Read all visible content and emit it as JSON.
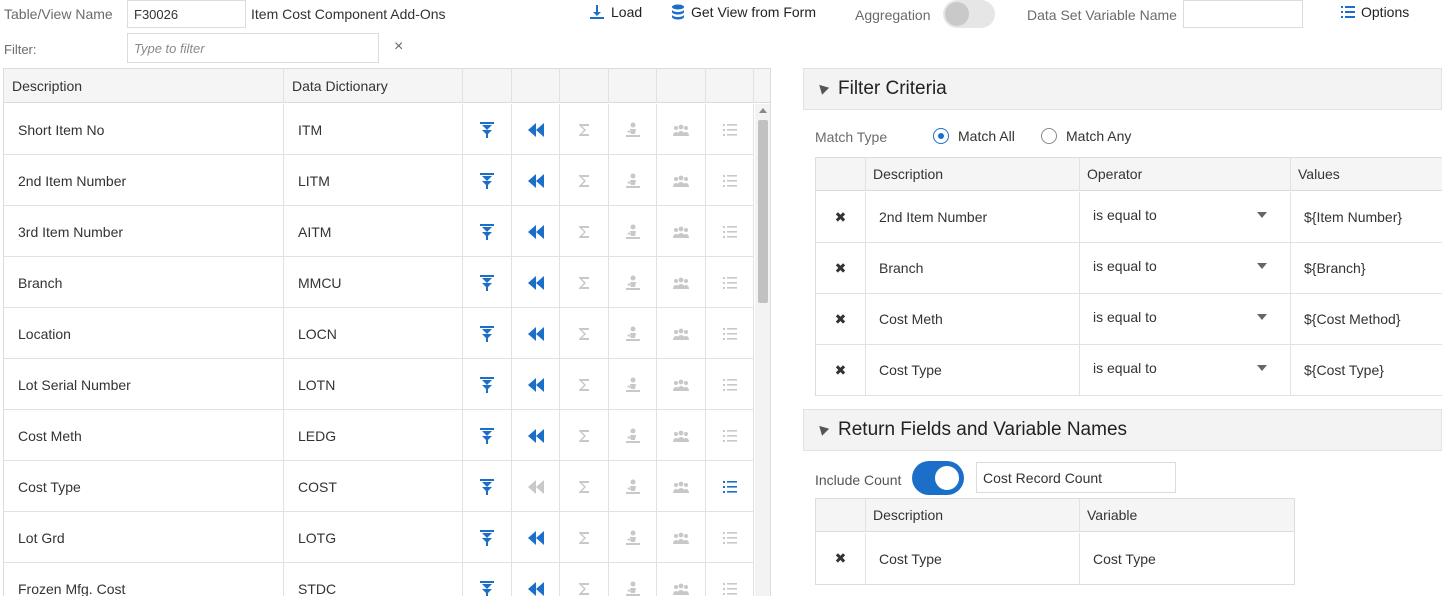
{
  "toolbar": {
    "table_view_label": "Table/View Name",
    "table_view_value": "F30026",
    "table_description": "Item Cost Component Add-Ons",
    "load_label": "Load",
    "get_view_label": "Get View from Form",
    "aggregation_label": "Aggregation",
    "aggregation_on": false,
    "dataset_var_label": "Data Set Variable Name",
    "dataset_var_value": "",
    "options_label": "Options",
    "filter_label": "Filter:",
    "filter_placeholder": "Type to filter",
    "clear_label": "×"
  },
  "columns_grid": {
    "headers": [
      "Description",
      "Data Dictionary"
    ],
    "rows": [
      {
        "description": "Short Item No",
        "dd": "ITM",
        "return_enabled": true,
        "list_active": false
      },
      {
        "description": "2nd Item Number",
        "dd": "LITM",
        "return_enabled": true,
        "list_active": false
      },
      {
        "description": "3rd Item Number",
        "dd": "AITM",
        "return_enabled": true,
        "list_active": false
      },
      {
        "description": "Branch",
        "dd": "MMCU",
        "return_enabled": true,
        "list_active": false
      },
      {
        "description": "Location",
        "dd": "LOCN",
        "return_enabled": true,
        "list_active": false
      },
      {
        "description": "Lot Serial Number",
        "dd": "LOTN",
        "return_enabled": true,
        "list_active": false
      },
      {
        "description": "Cost Meth",
        "dd": "LEDG",
        "return_enabled": true,
        "list_active": false
      },
      {
        "description": "Cost Type",
        "dd": "COST",
        "return_enabled": false,
        "list_active": true
      },
      {
        "description": "Lot Grd",
        "dd": "LOTG",
        "return_enabled": true,
        "list_active": false
      },
      {
        "description": "Frozen Mfg. Cost",
        "dd": "STDC",
        "return_enabled": true,
        "list_active": false
      }
    ],
    "icons": {
      "filter": "filter-down-icon",
      "return": "double-chevron-left-icon",
      "sum": "sigma-icon",
      "person": "person-chart-icon",
      "group": "group-icon",
      "list": "list-icon"
    }
  },
  "filter_criteria": {
    "title": "Filter Criteria",
    "match_type_label": "Match Type",
    "match_all_label": "Match All",
    "match_any_label": "Match Any",
    "selected": "all",
    "headers": [
      "Description",
      "Operator",
      "Values"
    ],
    "rows": [
      {
        "description": "2nd Item Number",
        "operator": "is equal to",
        "value": "${Item Number}"
      },
      {
        "description": "Branch",
        "operator": "is equal to",
        "value": "${Branch}"
      },
      {
        "description": "Cost Meth",
        "operator": "is equal to",
        "value": "${Cost Method}"
      },
      {
        "description": "Cost Type",
        "operator": "is equal to",
        "value": "${Cost Type}"
      }
    ]
  },
  "return_fields": {
    "title": "Return Fields and Variable Names",
    "include_count_label": "Include Count",
    "include_count_on": true,
    "count_var_value": "Cost Record Count",
    "headers": [
      "Description",
      "Variable"
    ],
    "rows": [
      {
        "description": "Cost Type",
        "variable": "Cost Type"
      }
    ]
  },
  "colors": {
    "accent": "#1b6fc8",
    "disabled_icon": "#c8c8c8"
  }
}
